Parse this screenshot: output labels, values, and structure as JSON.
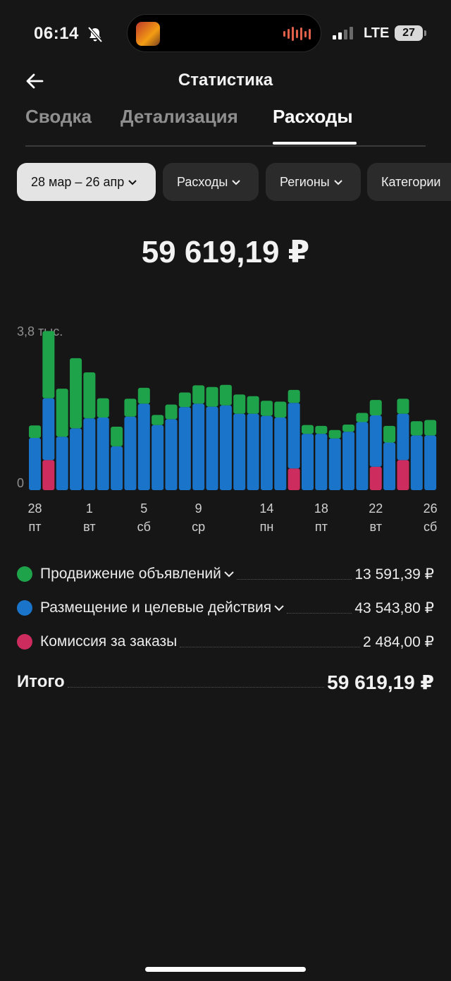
{
  "status_bar": {
    "time": "06:14",
    "network": "LTE",
    "battery": "27"
  },
  "header": {
    "title": "Статистика"
  },
  "tabs": [
    {
      "label": "Сводка",
      "active": false
    },
    {
      "label": "Детализация",
      "active": false
    },
    {
      "label": "Расходы",
      "active": true
    }
  ],
  "filters": [
    {
      "label": "28 мар – 26 апр",
      "selected": true
    },
    {
      "label": "Расходы",
      "selected": false
    },
    {
      "label": "Регионы",
      "selected": false
    },
    {
      "label": "Категории",
      "selected": false
    }
  ],
  "total_amount": "59 619,19 ₽",
  "chart_data": {
    "type": "bar",
    "stacked": true,
    "y_max_label": "3,8 тыс.",
    "y_min_label": "0",
    "ylim": [
      0,
      3800
    ],
    "colors": {
      "promotion": "#1fa34a",
      "placement": "#1a74c9",
      "commission": "#cc2d5e"
    },
    "categories": [
      "28 мар",
      "29 мар",
      "30 мар",
      "31 мар",
      "1 апр",
      "2 апр",
      "3 апр",
      "4 апр",
      "5 апр",
      "6 апр",
      "7 апр",
      "8 апр",
      "9 апр",
      "10 апр",
      "11 апр",
      "12 апр",
      "13 апр",
      "14 апр",
      "15 апр",
      "16 апр",
      "17 апр",
      "18 апр",
      "19 апр",
      "20 апр",
      "21 апр",
      "22 апр",
      "23 апр",
      "24 апр",
      "25 апр",
      "26 апр"
    ],
    "series": [
      {
        "name": "Комиссия за заказы",
        "key": "commission",
        "values": [
          0,
          720,
          0,
          0,
          0,
          0,
          0,
          0,
          0,
          0,
          0,
          0,
          0,
          0,
          0,
          0,
          0,
          0,
          0,
          520,
          0,
          0,
          0,
          0,
          0,
          560,
          0,
          720,
          0,
          0
        ]
      },
      {
        "name": "Размещение и целевые действия",
        "key": "placement",
        "values": [
          1250,
          1480,
          1280,
          1480,
          1720,
          1740,
          1050,
          1760,
          2070,
          1560,
          1700,
          1990,
          2070,
          2000,
          2030,
          1830,
          1830,
          1780,
          1740,
          1570,
          1350,
          1350,
          1240,
          1400,
          1630,
          1230,
          1140,
          1110,
          1310,
          1310
        ]
      },
      {
        "name": "Продвижение объявлений",
        "key": "promotion",
        "values": [
          300,
          1610,
          1150,
          1680,
          1100,
          460,
          470,
          430,
          380,
          240,
          350,
          350,
          440,
          470,
          490,
          460,
          420,
          360,
          380,
          310,
          210,
          190,
          200,
          170,
          220,
          370,
          400,
          360,
          340,
          370
        ]
      }
    ],
    "x_ticks": [
      {
        "index": 0,
        "day": "28",
        "weekday": "пт"
      },
      {
        "index": 4,
        "day": "1",
        "weekday": "вт"
      },
      {
        "index": 8,
        "day": "5",
        "weekday": "сб"
      },
      {
        "index": 12,
        "day": "9",
        "weekday": "ср"
      },
      {
        "index": 17,
        "day": "14",
        "weekday": "пн"
      },
      {
        "index": 21,
        "day": "18",
        "weekday": "пт"
      },
      {
        "index": 25,
        "day": "22",
        "weekday": "вт"
      },
      {
        "index": 29,
        "day": "26",
        "weekday": "сб"
      }
    ]
  },
  "legend": [
    {
      "name": "Продвижение объявлений",
      "value": "13 591,39 ₽",
      "color": "#1fa34a",
      "expandable": true
    },
    {
      "name": "Размещение и целевые действия",
      "value": "43 543,80 ₽",
      "color": "#1a74c9",
      "expandable": true
    },
    {
      "name": "Комиссия за заказы",
      "value": "2 484,00 ₽",
      "color": "#cc2d5e",
      "expandable": false
    }
  ],
  "summary": {
    "label": "Итого",
    "value": "59 619,19 ₽"
  }
}
